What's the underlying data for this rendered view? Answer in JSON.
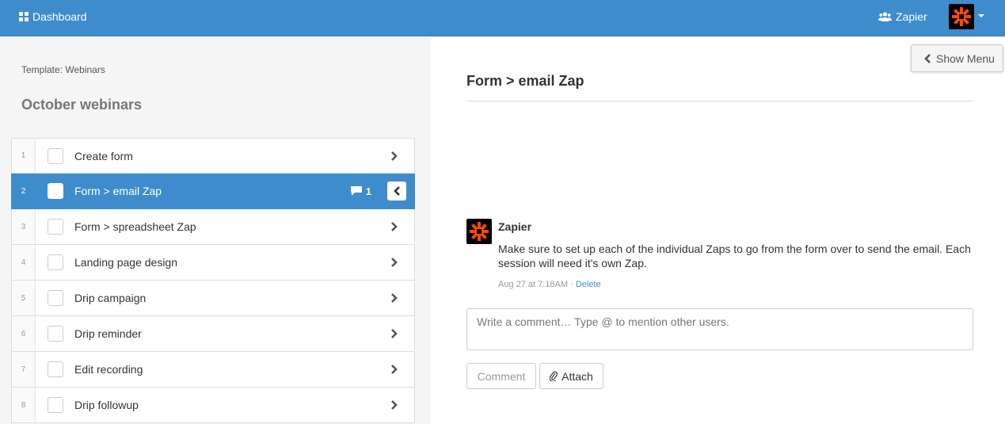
{
  "topbar": {
    "dashboard_label": "Dashboard",
    "user_label": "Zapier",
    "accent": "#3f8ccc",
    "logo_color": "#ff4a00"
  },
  "left": {
    "template_label": "Template: Webinars",
    "list_title": "October webinars",
    "tasks": [
      {
        "num": "1",
        "label": "Create form"
      },
      {
        "num": "2",
        "label": "Form > email Zap",
        "active": true,
        "comments": "1"
      },
      {
        "num": "3",
        "label": "Form > spreadsheet Zap"
      },
      {
        "num": "4",
        "label": "Landing page design"
      },
      {
        "num": "5",
        "label": "Drip campaign"
      },
      {
        "num": "6",
        "label": "Drip reminder"
      },
      {
        "num": "7",
        "label": "Edit recording"
      },
      {
        "num": "8",
        "label": "Drip followup"
      }
    ]
  },
  "detail": {
    "show_menu_label": "Show Menu",
    "title": "Form > email Zap",
    "comment": {
      "author": "Zapier",
      "text": "Make sure to set up each of the individual Zaps to go from the form over to send the email. Each session will need it's own Zap.",
      "time": "Aug 27 at 7:18AM",
      "separator": "·",
      "delete_label": "Delete"
    },
    "input_placeholder": "Write a comment… Type @ to mention other users.",
    "comment_button": "Comment",
    "attach_button": "Attach"
  }
}
